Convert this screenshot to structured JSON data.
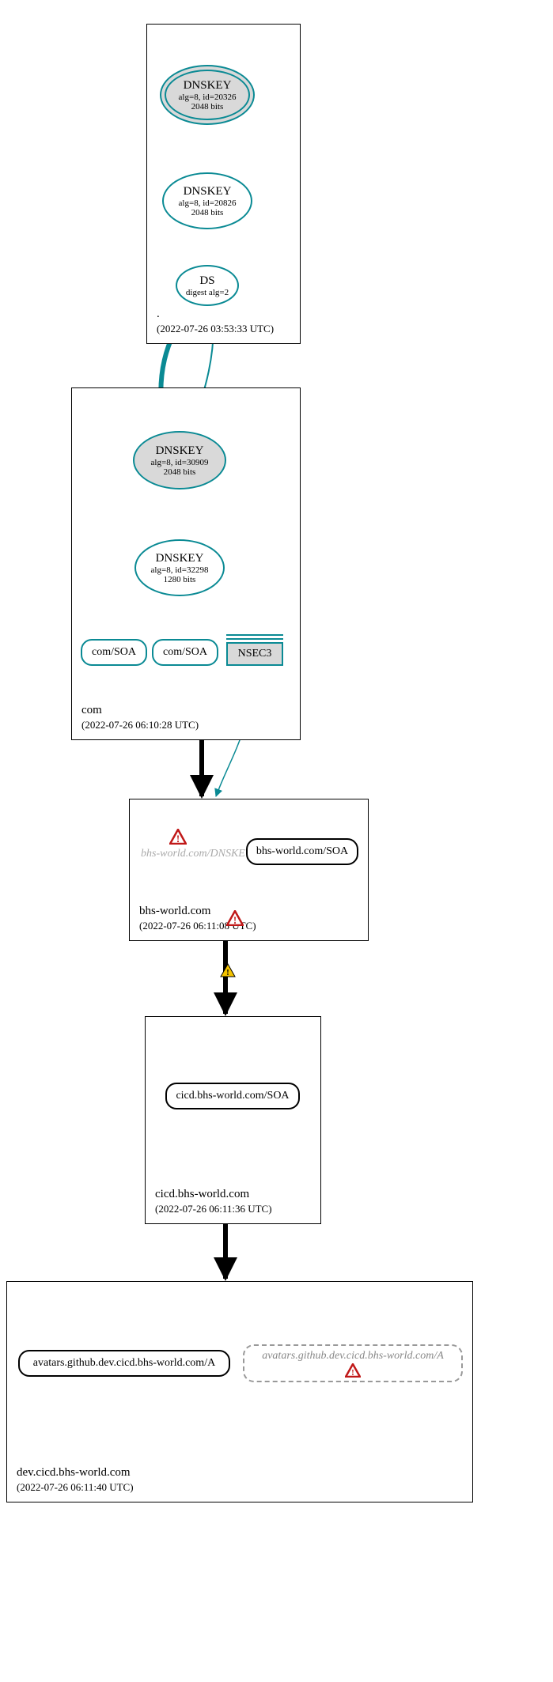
{
  "zones": {
    "root": {
      "name": ".",
      "timestamp": "(2022-07-26 03:53:33 UTC)"
    },
    "com": {
      "name": "com",
      "timestamp": "(2022-07-26 06:10:28 UTC)"
    },
    "bhs": {
      "name": "bhs-world.com",
      "timestamp": "(2022-07-26 06:11:08 UTC)"
    },
    "cicd": {
      "name": "cicd.bhs-world.com",
      "timestamp": "(2022-07-26 06:11:36 UTC)"
    },
    "dev": {
      "name": "dev.cicd.bhs-world.com",
      "timestamp": "(2022-07-26 06:11:40 UTC)"
    }
  },
  "nodes": {
    "root_ksk": {
      "title": "DNSKEY",
      "sub1": "alg=8, id=20326",
      "sub2": "2048 bits"
    },
    "root_zsk": {
      "title": "DNSKEY",
      "sub1": "alg=8, id=20826",
      "sub2": "2048 bits"
    },
    "root_ds": {
      "title": "DS",
      "sub1": "digest alg=2"
    },
    "com_ksk": {
      "title": "DNSKEY",
      "sub1": "alg=8, id=30909",
      "sub2": "2048 bits"
    },
    "com_zsk": {
      "title": "DNSKEY",
      "sub1": "alg=8, id=32298",
      "sub2": "1280 bits"
    },
    "com_soa1": "com/SOA",
    "com_soa2": "com/SOA",
    "nsec3": "NSEC3",
    "bhs_dnskey_ghost": "bhs-world.com/DNSKEY",
    "bhs_soa": "bhs-world.com/SOA",
    "cicd_soa": "cicd.bhs-world.com/SOA",
    "dev_a": "avatars.github.dev.cicd.bhs-world.com/A",
    "dev_a_ghost": "avatars.github.dev.cicd.bhs-world.com/A"
  },
  "colors": {
    "teal": "#0a8a94",
    "black": "#000000",
    "red": "#c01818",
    "yellow": "#f4c300",
    "grey_fill": "#d9d9d9"
  },
  "chart_data": {
    "type": "table",
    "description": "DNSSEC delegation / authentication graph (DNSViz-style).",
    "zones": [
      {
        "name": ".",
        "timestamp_utc": "2022-07-26 03:53:33",
        "nodes": [
          {
            "id": "root_ksk",
            "type": "DNSKEY",
            "alg": 8,
            "key_id": 20326,
            "bits": 2048,
            "role": "KSK",
            "self_sign": true
          },
          {
            "id": "root_zsk",
            "type": "DNSKEY",
            "alg": 8,
            "key_id": 20826,
            "bits": 2048,
            "role": "ZSK"
          },
          {
            "id": "root_ds",
            "type": "DS",
            "digest_alg": 2
          }
        ]
      },
      {
        "name": "com",
        "timestamp_utc": "2022-07-26 06:10:28",
        "nodes": [
          {
            "id": "com_ksk",
            "type": "DNSKEY",
            "alg": 8,
            "key_id": 30909,
            "bits": 2048,
            "role": "KSK",
            "self_sign": true
          },
          {
            "id": "com_zsk",
            "type": "DNSKEY",
            "alg": 8,
            "key_id": 32298,
            "bits": 1280,
            "role": "ZSK"
          },
          {
            "id": "com_soa1",
            "type": "RRset",
            "label": "com/SOA"
          },
          {
            "id": "com_soa2",
            "type": "RRset",
            "label": "com/SOA"
          },
          {
            "id": "nsec3",
            "type": "NSEC3"
          }
        ]
      },
      {
        "name": "bhs-world.com",
        "timestamp_utc": "2022-07-26 06:11:08",
        "status": "error",
        "nodes": [
          {
            "id": "bhs_dnskey",
            "type": "DNSKEY",
            "label": "bhs-world.com/DNSKEY",
            "missing": true,
            "status": "error"
          },
          {
            "id": "bhs_soa",
            "type": "RRset",
            "label": "bhs-world.com/SOA"
          }
        ]
      },
      {
        "name": "cicd.bhs-world.com",
        "timestamp_utc": "2022-07-26 06:11:36",
        "nodes": [
          {
            "id": "cicd_soa",
            "type": "RRset",
            "label": "cicd.bhs-world.com/SOA"
          }
        ]
      },
      {
        "name": "dev.cicd.bhs-world.com",
        "timestamp_utc": "2022-07-26 06:11:40",
        "nodes": [
          {
            "id": "dev_a",
            "type": "RRset",
            "label": "avatars.github.dev.cicd.bhs-world.com/A"
          },
          {
            "id": "dev_a_ghost",
            "type": "RRset",
            "label": "avatars.github.dev.cicd.bhs-world.com/A",
            "missing": true,
            "status": "error"
          }
        ]
      }
    ],
    "edges": [
      {
        "from": "root_ksk",
        "to": "root_ksk",
        "kind": "self-sign",
        "color": "teal"
      },
      {
        "from": "root_ksk",
        "to": "root_zsk",
        "kind": "signs",
        "color": "teal"
      },
      {
        "from": "root_zsk",
        "to": "root_ds",
        "kind": "signs",
        "color": "teal"
      },
      {
        "from": "root_ds",
        "to": "com_ksk",
        "kind": "delegation-secure",
        "color": "teal",
        "weight": "heavy"
      },
      {
        "from": "root_ds",
        "to": "com_ksk",
        "kind": "auth",
        "color": "teal"
      },
      {
        "from": "com_ksk",
        "to": "com_ksk",
        "kind": "self-sign",
        "color": "teal"
      },
      {
        "from": "com_ksk",
        "to": "com_zsk",
        "kind": "signs",
        "color": "teal"
      },
      {
        "from": "com_zsk",
        "to": "com_soa1",
        "kind": "signs",
        "color": "teal"
      },
      {
        "from": "com_zsk",
        "to": "com_soa2",
        "kind": "signs",
        "color": "teal"
      },
      {
        "from": "com_zsk",
        "to": "nsec3",
        "kind": "signs",
        "color": "teal"
      },
      {
        "from": "com_zsk",
        "to": "nsec3",
        "kind": "signs",
        "color": "teal"
      },
      {
        "from": "com",
        "to": "bhs-world.com",
        "kind": "delegation-insecure",
        "color": "black",
        "weight": "heavy"
      },
      {
        "from": "nsec3",
        "to": "bhs-world.com",
        "kind": "nsec-proof",
        "color": "teal"
      },
      {
        "from": "bhs-world.com",
        "to": "cicd.bhs-world.com",
        "kind": "delegation",
        "color": "black",
        "weight": "heavy",
        "status": "warning"
      },
      {
        "from": "cicd.bhs-world.com",
        "to": "dev.cicd.bhs-world.com",
        "kind": "delegation",
        "color": "black",
        "weight": "heavy"
      }
    ]
  }
}
